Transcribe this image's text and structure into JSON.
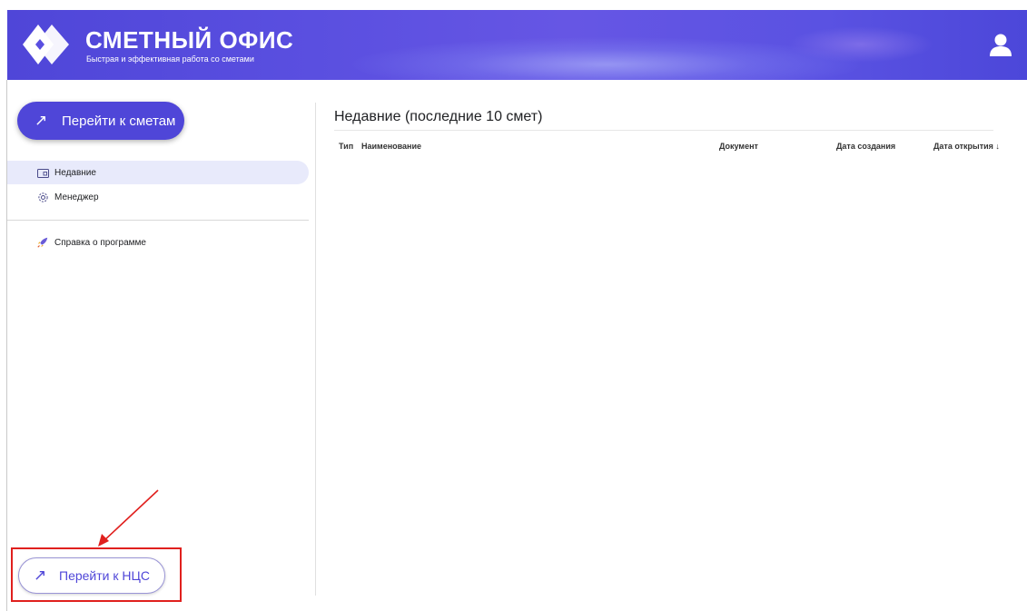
{
  "header": {
    "title": "СМЕТНЫЙ ОФИС",
    "subtitle": "Быстрая и эффективная работа со сметами",
    "logo_icon": "diamond-logo-icon",
    "user_icon": "user-avatar-icon",
    "colors": {
      "gradient_start": "#4f46d8",
      "gradient_end": "#6656e4"
    }
  },
  "sidebar": {
    "go_to_estimates": {
      "icon": "arrow-up-right-icon",
      "arrow": "↗",
      "label": "Перейти к сметам"
    },
    "items": [
      {
        "label": "Недавние",
        "icon": "folder-icon",
        "active": true
      },
      {
        "label": "Менеджер",
        "icon": "gear-icon",
        "active": false
      },
      {
        "label": "Справка о программе",
        "icon": "rocket-icon",
        "active": false
      }
    ],
    "go_to_ncs": {
      "icon": "arrow-up-right-icon",
      "arrow": "↗",
      "label": "Перейти к НЦС"
    }
  },
  "main": {
    "title": "Недавние (последние 10 смет)",
    "columns": [
      {
        "label": "Тип"
      },
      {
        "label": "Наименование"
      },
      {
        "label": "Документ"
      },
      {
        "label": "Дата создания"
      },
      {
        "label": "Дата открытия ↓"
      }
    ],
    "rows": []
  },
  "annotation": {
    "color": "#e0201e"
  }
}
